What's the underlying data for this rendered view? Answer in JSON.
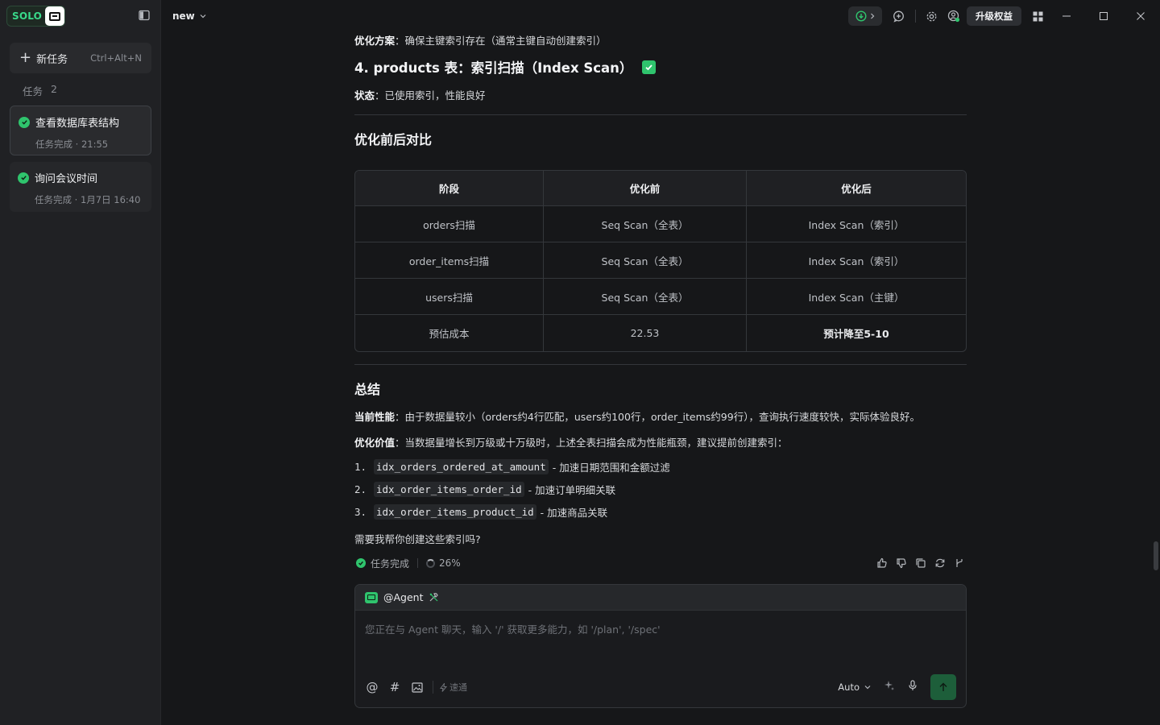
{
  "sidebar": {
    "brand": "SOLO",
    "new_task_label": "新任务",
    "new_task_shortcut": "Ctrl+Alt+N",
    "tasks_label": "任务",
    "tasks_count": "2",
    "tasks": [
      {
        "title": "查看数据库表结构",
        "status": "任务完成 · 21:55"
      },
      {
        "title": "询问会议时间",
        "status": "任务完成 · 1月7日 16:40"
      }
    ]
  },
  "topbar": {
    "project": "new",
    "upgrade_label": "升级权益"
  },
  "content": {
    "opt_plan_label": "优化方案",
    "opt_plan_text": "：确保主键索引存在（通常主键自动创建索引）",
    "section4_title": "4. products 表：索引扫描（Index Scan）",
    "status_label": "状态",
    "status_text": "：已使用索引，性能良好",
    "compare_title": "优化前后对比",
    "table": {
      "headers": [
        "阶段",
        "优化前",
        "优化后"
      ],
      "rows": [
        [
          "orders扫描",
          "Seq Scan（全表）",
          "Index Scan（索引）"
        ],
        [
          "order_items扫描",
          "Seq Scan（全表）",
          "Index Scan（索引）"
        ],
        [
          "users扫描",
          "Seq Scan（全表）",
          "Index Scan（主键）"
        ],
        [
          "预估成本",
          "22.53",
          "预计降至5-10"
        ]
      ]
    },
    "summary_title": "总结",
    "perf_label": "当前性能",
    "perf_text": "：由于数据量较小（orders约4行匹配，users约100行，order_items约99行），查询执行速度较快，实际体验良好。",
    "value_label": "优化价值",
    "value_text": "：当数据量增长到万级或十万级时，上述全表扫描会成为性能瓶颈，建议提前创建索引：",
    "indexes": [
      {
        "num": "1.",
        "code": "idx_orders_ordered_at_amount",
        "desc": "- 加速日期范围和金额过滤"
      },
      {
        "num": "2.",
        "code": "idx_order_items_order_id",
        "desc": "- 加速订单明细关联"
      },
      {
        "num": "3.",
        "code": "idx_order_items_product_id",
        "desc": "- 加速商品关联"
      }
    ],
    "question": "需要我帮你创建这些索引吗?",
    "task_done": "任务完成",
    "progress": "26%"
  },
  "composer": {
    "agent": "@Agent",
    "placeholder": "您正在与 Agent 聊天，输入 '/' 获取更多能力，如 '/plan', '/spec'",
    "speed_label": "速通",
    "model": "Auto"
  },
  "colors": {
    "accent": "#2fc46d",
    "background": "#161719",
    "sidebar": "#202124"
  }
}
